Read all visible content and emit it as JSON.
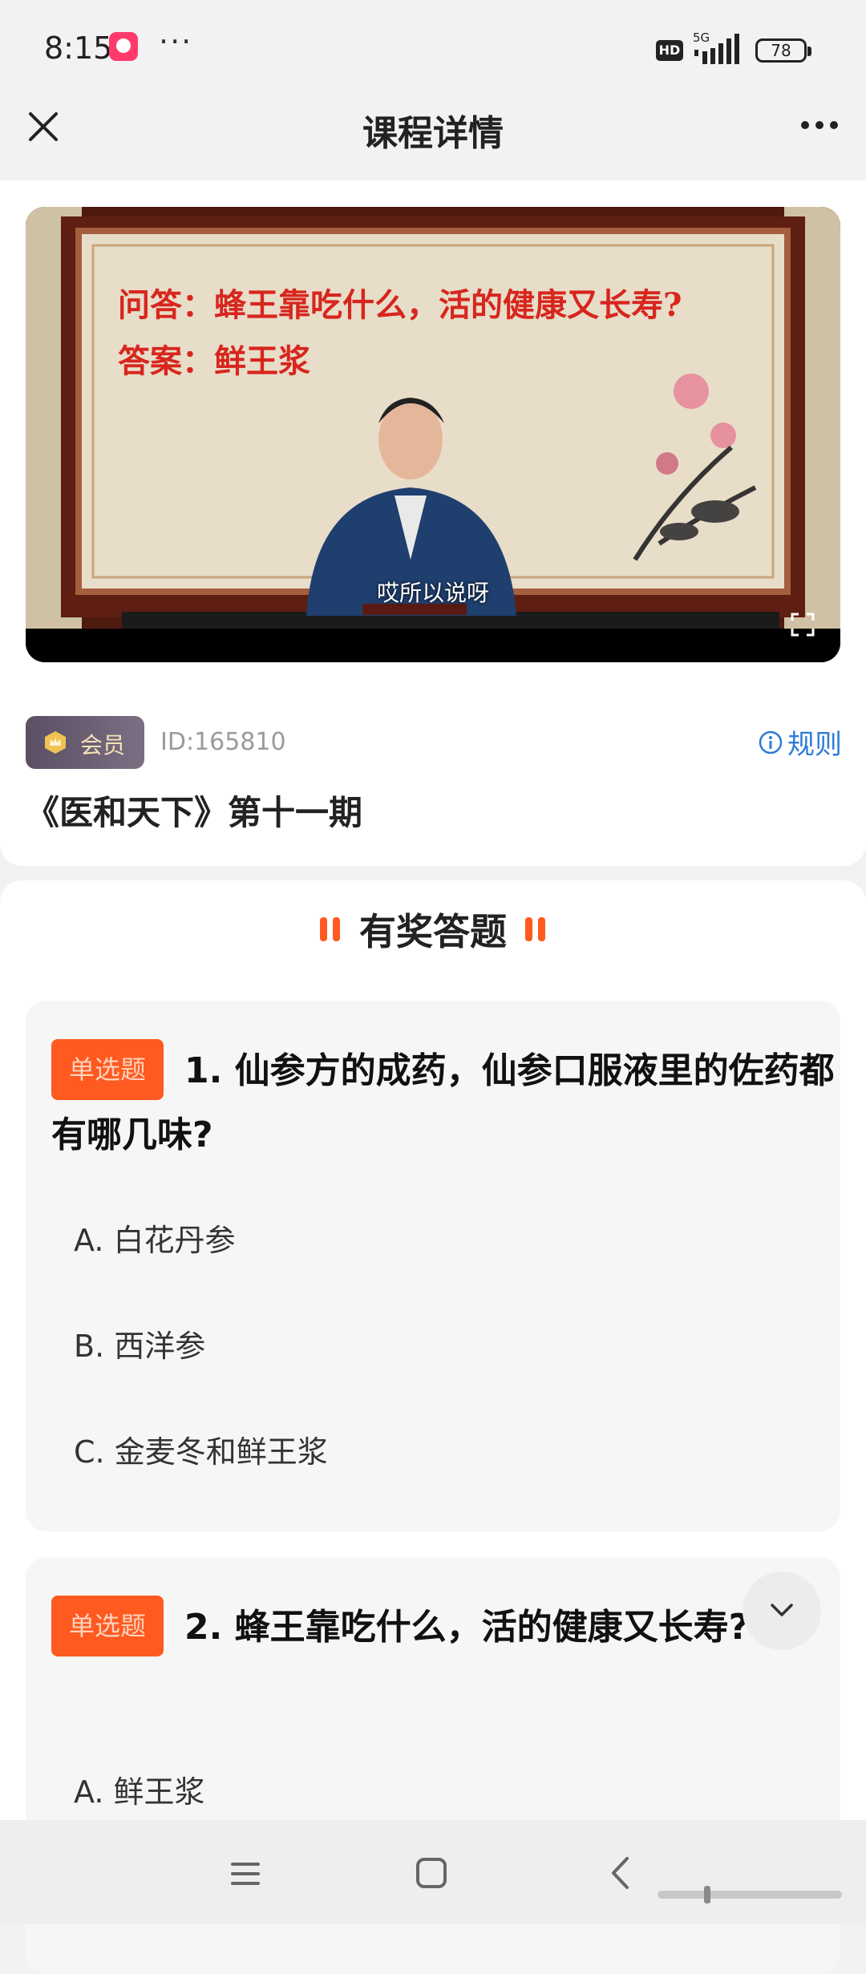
{
  "status_bar": {
    "time": "8:15",
    "dots": "···",
    "hd_label": "HD",
    "network": "5G",
    "battery": "78"
  },
  "nav": {
    "title": "课程详情",
    "close_icon": "close-icon",
    "more_icon": "more-icon"
  },
  "course": {
    "video": {
      "question_text": "问答：蜂王靠吃什么，活的健康又长寿?",
      "answer_text": "答案：鲜王浆",
      "subtitle": "哎所以说呀"
    },
    "member_label": "会员",
    "id_text": "ID:165810",
    "rules_label": "规则",
    "title": "《医和天下》第十一期"
  },
  "quiz": {
    "heading": "有奖答题",
    "questions": [
      {
        "type_label": "单选题",
        "text": "1. 仙参方的成药，仙参口服液里的佐药都有哪几味?",
        "options": [
          "A. 白花丹参",
          "B. 西洋参",
          "C. 金麦冬和鲜王浆"
        ]
      },
      {
        "type_label": "单选题",
        "text": "2. 蜂王靠吃什么，活的健康又长寿?",
        "options": [
          "A. 鲜王浆"
        ]
      }
    ]
  },
  "colors": {
    "accent": "#ff5a1f",
    "link": "#2f7bd6",
    "video_text": "#d7261e"
  }
}
